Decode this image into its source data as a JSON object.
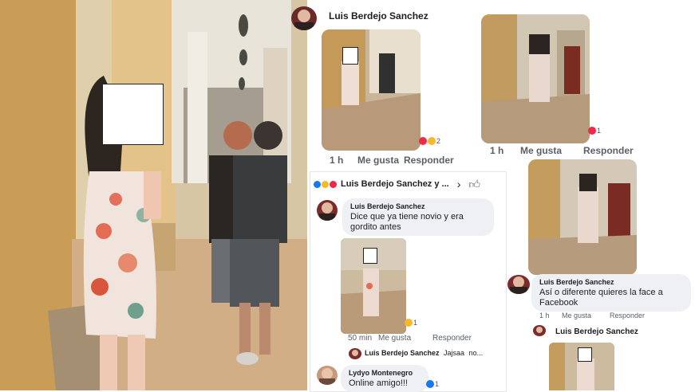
{
  "post_header": {
    "author": "Luis Berdejo Sanchez"
  },
  "comment1": {
    "time": "1 h",
    "like": "Me gusta",
    "reply": "Responder",
    "reactions": "2"
  },
  "comment2": {
    "time": "1 h",
    "like": "Me gusta",
    "reply": "Responder",
    "reactions": "1"
  },
  "panel": {
    "header": "Luis Berdejo Sanchez y ...",
    "comment_author": "Luis Berdejo Sanchez",
    "comment_text": "Dice que ya tiene novio y era gordito antes",
    "photo_time": "50 min",
    "photo_like": "Me gusta",
    "photo_reply": "Responder",
    "photo_reactions": "1",
    "reply_author": "Luis Berdejo Sanchez",
    "reply_text": "Jajsaa",
    "reply_more": "no...",
    "comment3_author": "Lydyo Montenegro",
    "comment3_text": "Online amigo!!!",
    "comment3_reactions": "1"
  },
  "right_comment": {
    "author": "Luis Berdejo Sanchez",
    "text": "Así o diferente quieres la face a Facebook",
    "time": "1 h",
    "like": "Me gusta",
    "reply": "Responder"
  },
  "bottom_right": {
    "author": "Luis Berdejo Sanchez"
  },
  "colors": {
    "fb_blue": "#1877f2",
    "love_red": "#f0284a",
    "haha_yellow": "#f7b928"
  }
}
